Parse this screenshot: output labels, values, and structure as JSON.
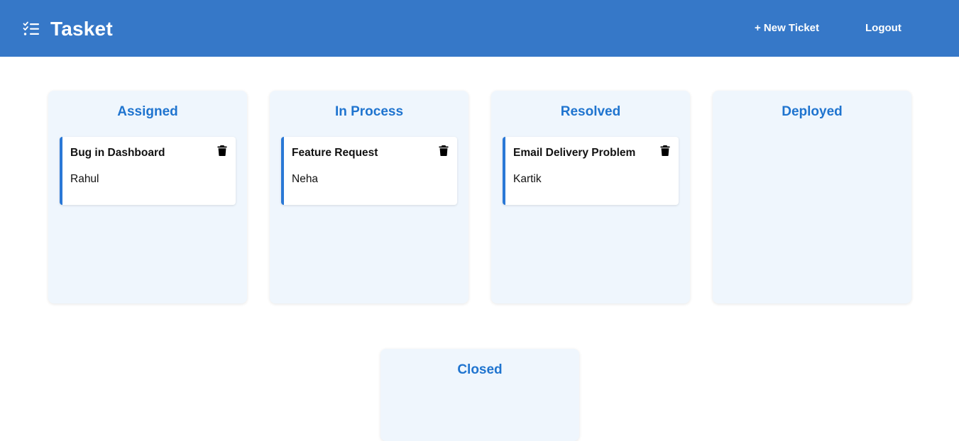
{
  "header": {
    "app_title": "Tasket",
    "brand_icon": "task-list-icon",
    "new_ticket_label": "+ New Ticket",
    "logout_label": "Logout",
    "bg_color": "#3678c8"
  },
  "board": {
    "columns": [
      {
        "title": "Assigned",
        "tickets": [
          {
            "title": "Bug in Dashboard",
            "assignee": "Rahul",
            "delete_icon": "trash-icon"
          }
        ]
      },
      {
        "title": "In Process",
        "tickets": [
          {
            "title": "Feature Request",
            "assignee": "Neha",
            "delete_icon": "trash-icon"
          }
        ]
      },
      {
        "title": "Resolved",
        "tickets": [
          {
            "title": "Email Delivery Problem",
            "assignee": "Kartik",
            "delete_icon": "trash-icon"
          }
        ]
      },
      {
        "title": "Deployed",
        "tickets": []
      },
      {
        "title": "Closed",
        "tickets": []
      }
    ],
    "accent_color": "#1f74cf",
    "column_bg_color": "#eff6fd"
  }
}
